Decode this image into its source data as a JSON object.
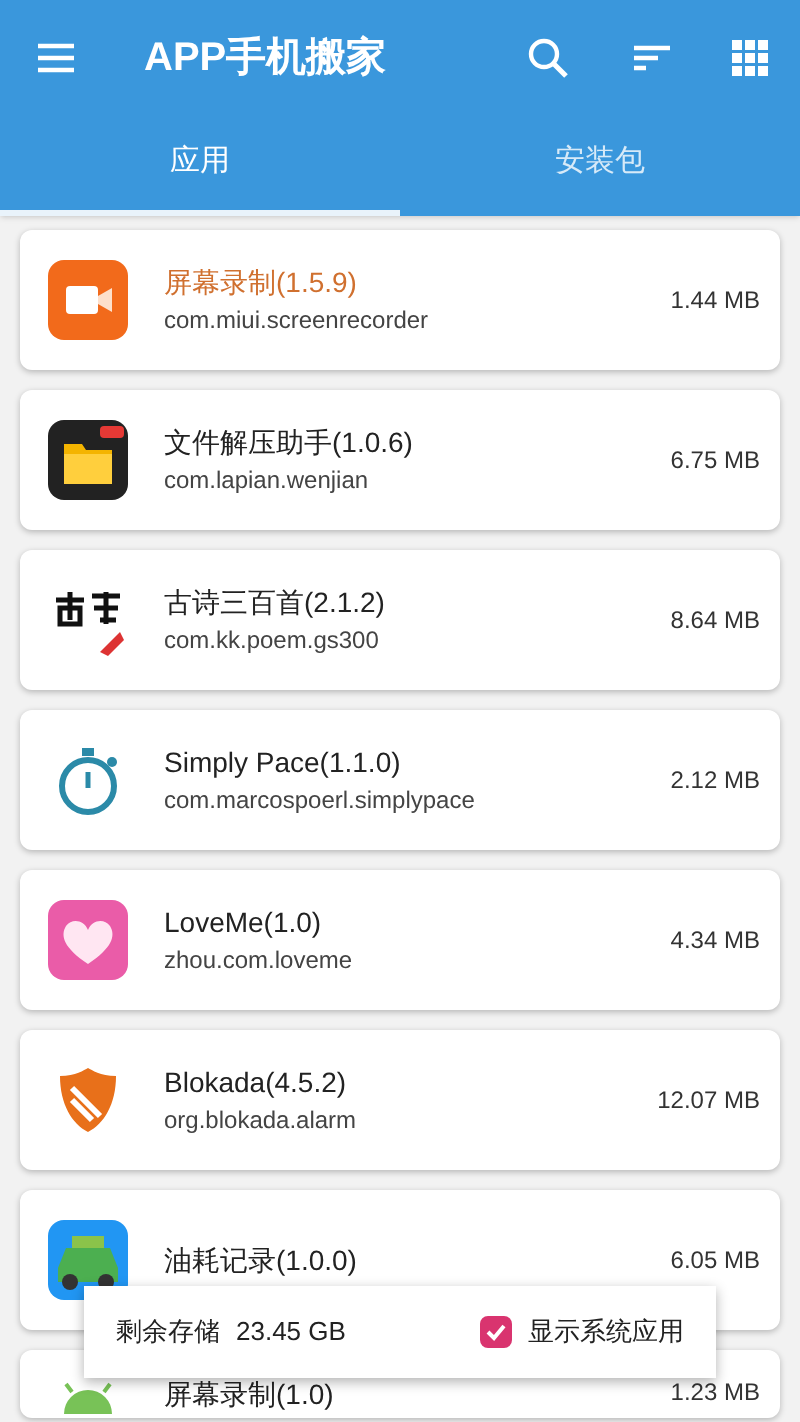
{
  "app_bar": {
    "title": "APP手机搬家"
  },
  "tabs": [
    {
      "label": "应用",
      "selected": true
    },
    {
      "label": "安装包",
      "selected": false
    }
  ],
  "apps": [
    {
      "name": "屏幕录制(1.5.9)",
      "package": "com.miui.screenrecorder",
      "size": "1.44 MB",
      "highlighted": true
    },
    {
      "name": "文件解压助手(1.0.6)",
      "package": "com.lapian.wenjian",
      "size": "6.75 MB",
      "highlighted": false
    },
    {
      "name": "古诗三百首(2.1.2)",
      "package": "com.kk.poem.gs300",
      "size": "8.64 MB",
      "highlighted": false
    },
    {
      "name": "Simply Pace(1.1.0)",
      "package": "com.marcospoerl.simplypace",
      "size": "2.12 MB",
      "highlighted": false
    },
    {
      "name": "LoveMe(1.0)",
      "package": "zhou.com.loveme",
      "size": "4.34 MB",
      "highlighted": false
    },
    {
      "name": "Blokada(4.5.2)",
      "package": "org.blokada.alarm",
      "size": "12.07 MB",
      "highlighted": false
    },
    {
      "name": "油耗记录(1.0.0)",
      "size": "6.05 MB",
      "highlighted": false
    },
    {
      "name": "屏幕录制(1.0)",
      "size": "1.23 MB",
      "highlighted": false
    }
  ],
  "bottom_bar": {
    "storage_label": "剩余存储",
    "storage_value": "23.45 GB",
    "show_system": {
      "label": "显示系统应用",
      "checked": true
    }
  }
}
